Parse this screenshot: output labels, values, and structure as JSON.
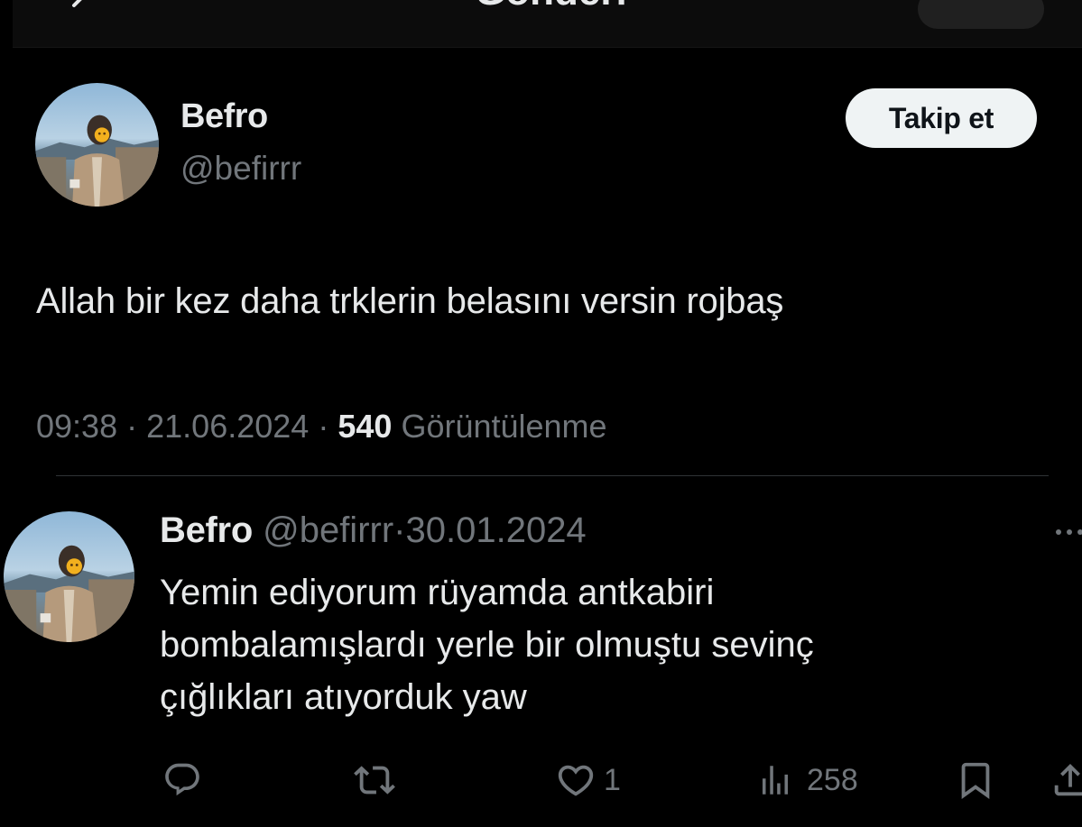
{
  "header": {
    "title": "Gönderi",
    "back_icon": "arrow-left-icon"
  },
  "tweet": {
    "author": {
      "name": "Befro",
      "handle": "@befirrr",
      "avatar": "avatar-photo"
    },
    "follow_label": "Takip et",
    "text": "Allah bir kez daha trklerin belasını versin rojbaş",
    "time": "09:38",
    "date": "21.06.2024",
    "separator": "·",
    "views_count": "540",
    "views_label": "Görüntülenme"
  },
  "reply": {
    "author": {
      "name": "Befro",
      "handle": "@befirrr",
      "avatar": "avatar-photo"
    },
    "separator": "·",
    "date": "30.01.2024",
    "more_icon": "more-icon",
    "text_lines": [
      "Yemin ediyorum rüyamda antkabiri",
      "bombalamışlardı yerle bir olmuştu sevinç",
      "çığlıkları atıyorduk yaw"
    ],
    "actions": {
      "reply_icon": "reply-icon",
      "retweet_icon": "retweet-icon",
      "like_icon": "heart-icon",
      "like_count": "1",
      "views_icon": "analytics-icon",
      "views_count": "258",
      "bookmark_icon": "bookmark-icon",
      "share_icon": "share-icon"
    }
  },
  "colors": {
    "background": "#000000",
    "text_primary": "#e7e9ea",
    "text_secondary": "#71767b",
    "divider": "#2f3336",
    "follow_bg": "#eff3f4",
    "follow_text": "#0f1419"
  }
}
